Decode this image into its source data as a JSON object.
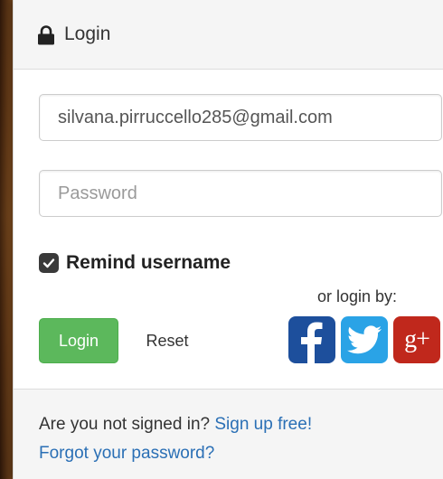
{
  "header": {
    "icon": "lock-icon",
    "title": "Login"
  },
  "form": {
    "email_value": "silvana.pirruccello285@gmail.com",
    "password_placeholder": "Password",
    "remember_label": "Remind username",
    "remember_checked": true,
    "login_label": "Login",
    "reset_label": "Reset"
  },
  "social": {
    "prompt": "or login by:",
    "providers": [
      {
        "name": "facebook",
        "icon": "facebook-icon",
        "color": "#1d4f9c"
      },
      {
        "name": "twitter",
        "icon": "twitter-icon",
        "color": "#2aa3e6"
      },
      {
        "name": "google-plus",
        "icon": "google-plus-icon",
        "label": "g+",
        "color": "#c0281c"
      }
    ]
  },
  "footer": {
    "signup_prompt": "Are you not signed in?",
    "signup_link": "Sign up free!",
    "forgot_link": "Forgot your password?"
  },
  "colors": {
    "primary_button": "#5cb85c",
    "link": "#2a6fb5"
  }
}
